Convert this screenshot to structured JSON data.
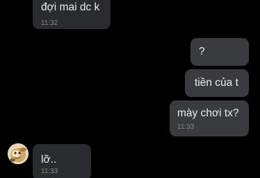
{
  "messages": [
    {
      "direction": "incoming",
      "text": "đợi mai dc k",
      "time": "11:32"
    },
    {
      "direction": "outgoing",
      "text": "?",
      "time": ""
    },
    {
      "direction": "outgoing",
      "text": "tiền của t",
      "time": ""
    },
    {
      "direction": "outgoing",
      "text": "mày chơi tx?",
      "time": "11:33"
    },
    {
      "direction": "incoming",
      "text": "lỡ..",
      "time": "11:33"
    }
  ],
  "colors": {
    "background": "#000000",
    "incoming_bubble": "#2a2b2e",
    "outgoing_bubble": "#3a3b3f",
    "text": "#ececec",
    "timestamp": "#8a8a8a"
  },
  "icons": {
    "sender_avatar": "avatar-icon"
  }
}
